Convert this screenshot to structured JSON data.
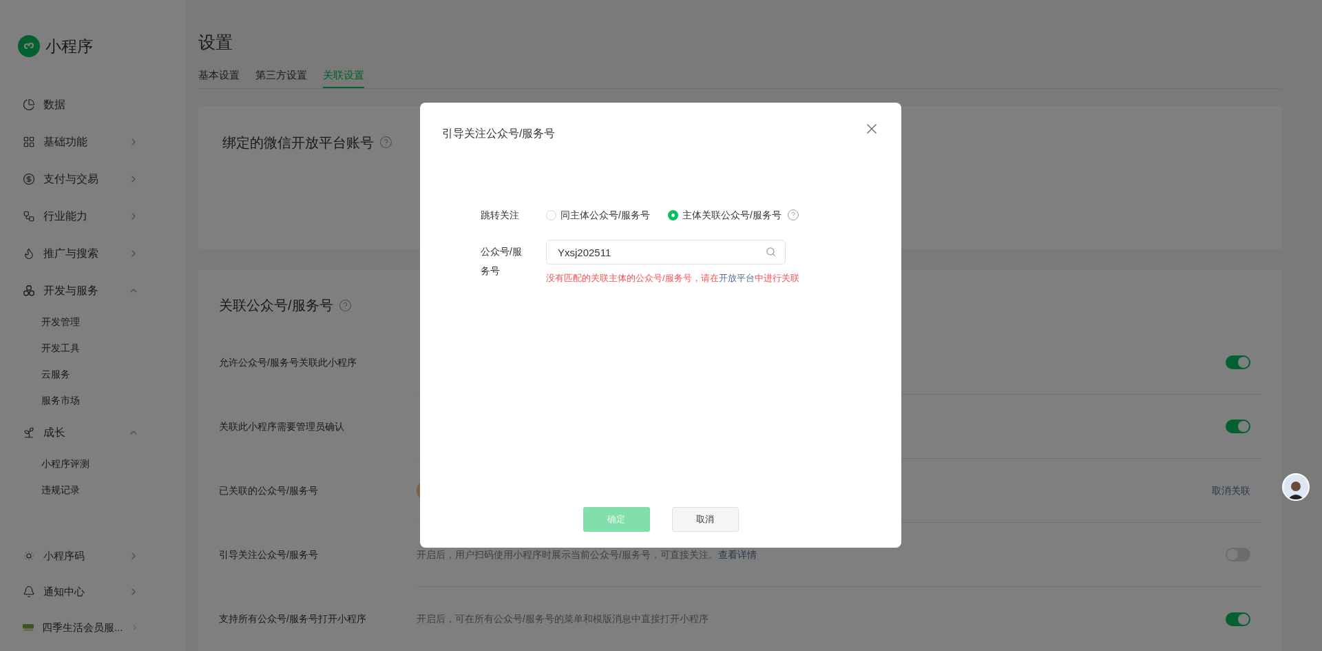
{
  "brand": {
    "name": "小程序"
  },
  "sidebar": {
    "items": [
      {
        "label": "数据"
      },
      {
        "label": "基础功能",
        "expanded": false
      },
      {
        "label": "支付与交易",
        "expanded": false
      },
      {
        "label": "行业能力",
        "expanded": false
      },
      {
        "label": "推广与搜索",
        "expanded": false
      },
      {
        "label": "开发与服务",
        "expanded": true,
        "children": [
          {
            "label": "开发管理"
          },
          {
            "label": "开发工具"
          },
          {
            "label": "云服务"
          },
          {
            "label": "服务市场"
          }
        ]
      },
      {
        "label": "成长",
        "expanded": true,
        "children": [
          {
            "label": "小程序评测"
          },
          {
            "label": "违规记录"
          }
        ]
      }
    ],
    "footer_items": [
      {
        "label": "小程序码",
        "expanded": false
      },
      {
        "label": "通知中心",
        "expanded": false
      },
      {
        "label": "四季生活会员服...",
        "expanded": false
      }
    ]
  },
  "page": {
    "title": "设置",
    "tabs": [
      {
        "label": "基本设置",
        "selected": false
      },
      {
        "label": "第三方设置",
        "selected": false
      },
      {
        "label": "关联设置",
        "selected": true
      }
    ]
  },
  "open_platform_card": {
    "title": "绑定的微信开放平台账号"
  },
  "link_card": {
    "title": "关联公众号/服务号",
    "rows": [
      {
        "label": "允许公众号/服务号关联此小程序",
        "control": {
          "kind": "toggle",
          "on": true
        }
      },
      {
        "label": "关联此小程序需要管理员确认",
        "control": {
          "kind": "toggle",
          "on": true
        }
      },
      {
        "label": "已关联的公众号/服务号",
        "control": {
          "kind": "link",
          "text": "取消关联"
        }
      },
      {
        "label": "引导关注公众号/服务号",
        "description": "开启后，用户扫码使用小程序时展示当前公众号/服务号，可直接关注。",
        "description_link": "查看详情",
        "control": {
          "kind": "toggle",
          "on": false
        }
      },
      {
        "label": "支持所有公众号/服务号打开小程序",
        "description": "开启后，可在所有公众号/服务号的菜单和模版消息中直接打开小程序",
        "control": {
          "kind": "toggle",
          "on": true
        }
      }
    ]
  },
  "dialog": {
    "title": "引导关注公众号/服务号",
    "follow_label": "跳转关注",
    "options": [
      {
        "label": "同主体公众号/服务号",
        "selected": false
      },
      {
        "label": "主体关联公众号/服务号",
        "selected": true
      }
    ],
    "account_label": "公众号/服务号",
    "account_value": "Yxsj202511",
    "error_before": "没有匹配的关联主体的公众号/服务号，请在",
    "error_link": "开放平台",
    "error_after": "中进行关联",
    "confirm": {
      "label": "确定",
      "disabled": true
    },
    "cancel": {
      "label": "取消"
    }
  }
}
